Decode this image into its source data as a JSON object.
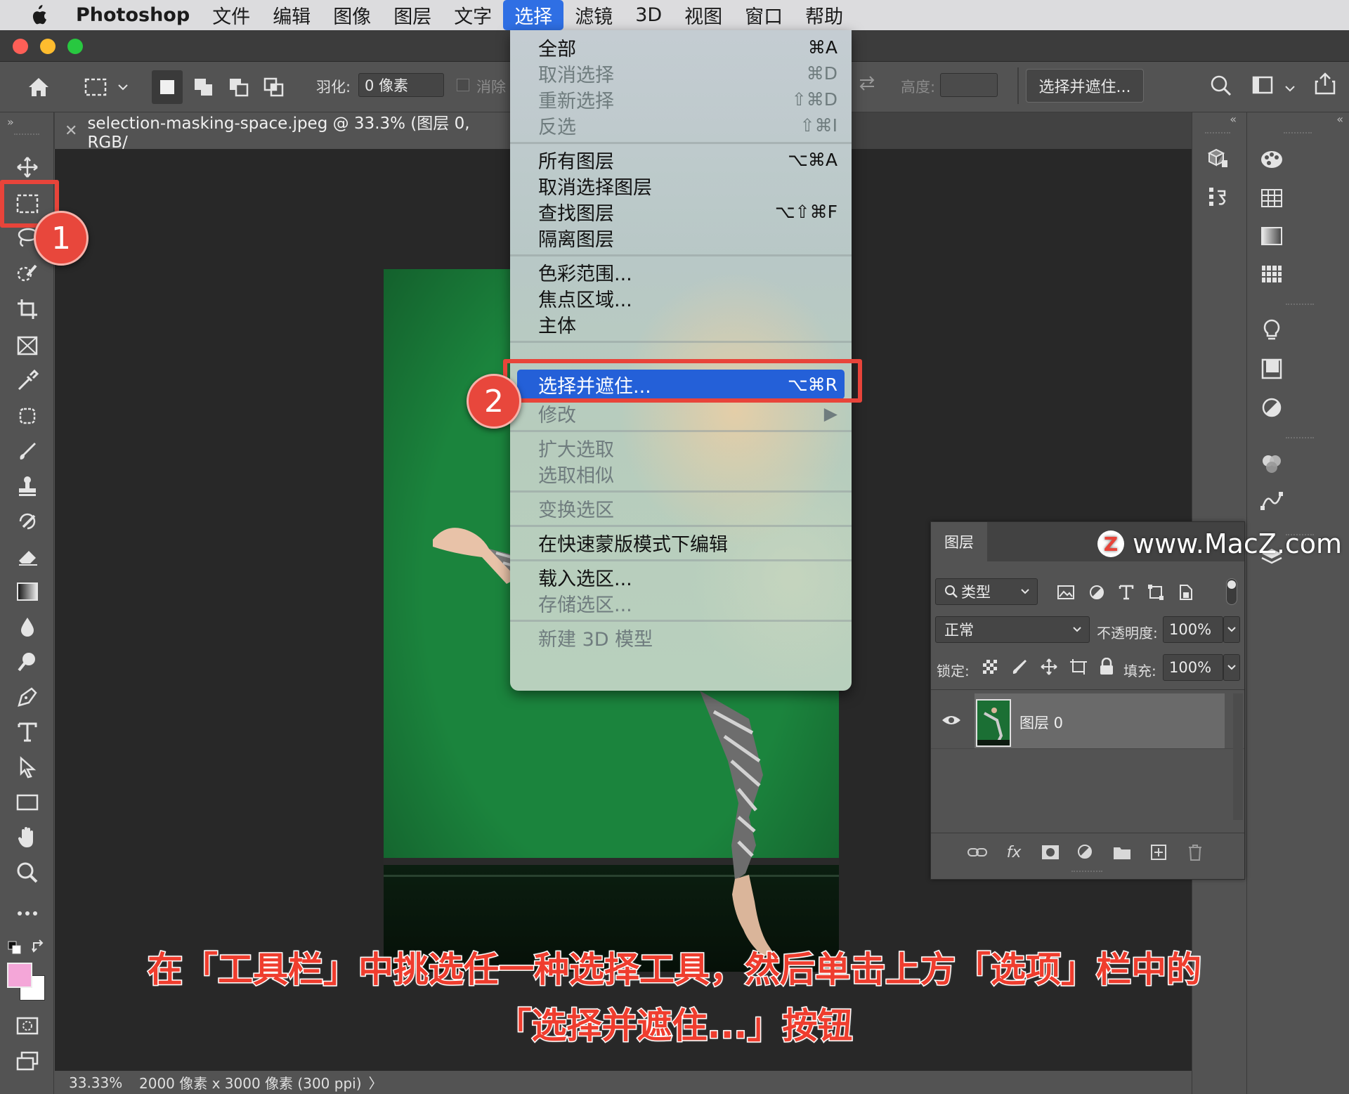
{
  "menubar": {
    "app": "Photoshop",
    "items": [
      "文件",
      "编辑",
      "图像",
      "图层",
      "文字",
      "选择",
      "滤镜",
      "3D",
      "视图",
      "窗口",
      "帮助"
    ]
  },
  "options": {
    "feather_label": "羽化:",
    "feather_value": "0 像素",
    "antialias_label": "消除",
    "height_label": "高度:",
    "select_mask_button": "选择并遮住..."
  },
  "document": {
    "tab_title": "selection-masking-space.jpeg @ 33.3% (图层 0, RGB/"
  },
  "status": {
    "zoom": "33.33%",
    "info": "2000 像素 x 3000 像素 (300 ppi)",
    "chevron": "〉"
  },
  "select_menu": {
    "groups": [
      [
        {
          "label": "全部",
          "shortcut": "⌘A",
          "enabled": true
        },
        {
          "label": "取消选择",
          "shortcut": "⌘D",
          "enabled": false
        },
        {
          "label": "重新选择",
          "shortcut": "⇧⌘D",
          "enabled": false
        },
        {
          "label": "反选",
          "shortcut": "⇧⌘I",
          "enabled": false
        }
      ],
      [
        {
          "label": "所有图层",
          "shortcut": "⌥⌘A",
          "enabled": true
        },
        {
          "label": "取消选择图层",
          "shortcut": "",
          "enabled": true
        },
        {
          "label": "查找图层",
          "shortcut": "⌥⇧⌘F",
          "enabled": true
        },
        {
          "label": "隔离图层",
          "shortcut": "",
          "enabled": true
        }
      ],
      [
        {
          "label": "色彩范围...",
          "shortcut": "",
          "enabled": true
        },
        {
          "label": "焦点区域...",
          "shortcut": "",
          "enabled": true
        },
        {
          "label": "主体",
          "shortcut": "",
          "enabled": true
        }
      ],
      [
        {
          "label": "选择并遮住...",
          "shortcut": "⌥⌘R",
          "enabled": true,
          "highlighted": true
        },
        {
          "label": "修改",
          "shortcut": "▶",
          "enabled": false
        }
      ],
      [
        {
          "label": "扩大选取",
          "shortcut": "",
          "enabled": false
        },
        {
          "label": "选取相似",
          "shortcut": "",
          "enabled": false
        }
      ],
      [
        {
          "label": "变换选区",
          "shortcut": "",
          "enabled": false
        }
      ],
      [
        {
          "label": "在快速蒙版模式下编辑",
          "shortcut": "",
          "enabled": true
        }
      ],
      [
        {
          "label": "载入选区...",
          "shortcut": "",
          "enabled": true
        },
        {
          "label": "存储选区...",
          "shortcut": "",
          "enabled": false
        }
      ],
      [
        {
          "label": "新建 3D 模型",
          "shortcut": "",
          "enabled": false
        }
      ]
    ]
  },
  "layers_panel": {
    "tab": "图层",
    "filter": "类型",
    "blend_mode": "正常",
    "opacity_label": "不透明度:",
    "opacity": "100%",
    "lock_label": "锁定:",
    "fill_label": "填充:",
    "fill": "100%",
    "layer_name": "图层 0",
    "fx": "fx"
  },
  "callouts": {
    "badge1": "1",
    "badge2": "2"
  },
  "caption": {
    "line1": "在「工具栏」中挑选任一种选择工具，然后单击上方「选项」栏中的",
    "line2": "「选择并遮住...」按钮"
  },
  "watermark": {
    "logo": "Z",
    "text": "www.MacZ.com"
  },
  "colors": {
    "menu_highlight": "#2460d8",
    "callout_red": "#e8443a",
    "foreground_swatch": "#f4a6d8",
    "background_swatch": "#ffffff",
    "green_screen": "#1a8a3f"
  },
  "icons": [
    "apple-icon",
    "home-icon",
    "marquee-icon",
    "move-icon",
    "lasso-icon",
    "quick-select-icon",
    "crop-icon",
    "frame-icon",
    "eyedropper-icon",
    "patch-icon",
    "brush-icon",
    "stamp-icon",
    "history-brush-icon",
    "eraser-icon",
    "gradient-icon",
    "blur-icon",
    "dodge-icon",
    "pen-icon",
    "type-icon",
    "path-select-icon",
    "rectangle-icon",
    "hand-icon",
    "zoom-icon",
    "more-icon",
    "search-icon",
    "workspace-icon",
    "share-icon",
    "eye-icon",
    "link-icon",
    "trash-icon"
  ]
}
